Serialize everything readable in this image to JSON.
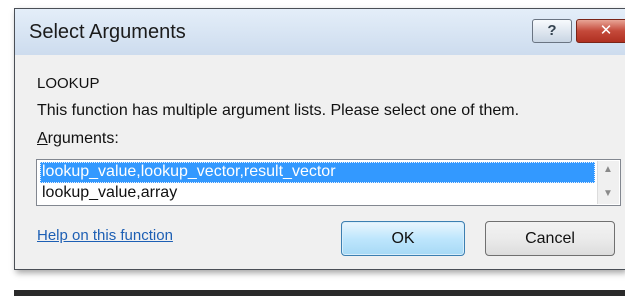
{
  "window": {
    "title": "Select Arguments",
    "help_button_label": "?",
    "close_button_label": "✕"
  },
  "function_name": "LOOKUP",
  "description": "This function has multiple argument lists.  Please select one of them.",
  "arguments": {
    "label_accel": "A",
    "label_rest": "rguments:",
    "items": [
      {
        "label": "lookup_value,lookup_vector,result_vector",
        "selected": true
      },
      {
        "label": "lookup_value,array",
        "selected": false
      }
    ],
    "scroll_up_icon": "▲",
    "scroll_down_icon": "▼"
  },
  "help_link": "Help on this function",
  "buttons": {
    "ok": "OK",
    "cancel": "Cancel"
  },
  "colors": {
    "selection": "#3399ff",
    "link": "#1d5fb4",
    "close_button": "#c4493a"
  }
}
